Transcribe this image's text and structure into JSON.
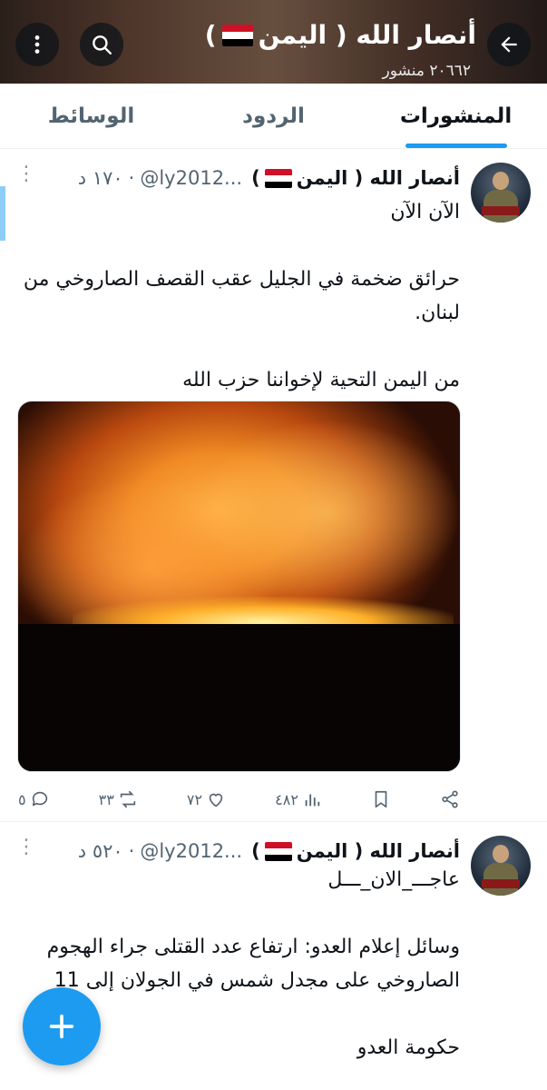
{
  "header": {
    "title": "أنصار الله ( اليمن",
    "title_close": ")",
    "subtitle": "٢٠٦٦٢ منشور"
  },
  "tabs": [
    {
      "label": "المنشورات",
      "active": true
    },
    {
      "label": "الردود",
      "active": false
    },
    {
      "label": "الوسائط",
      "active": false
    }
  ],
  "posts": [
    {
      "name": "أنصار الله ( اليمن",
      "name_close": ")",
      "handle": "@ly2012...",
      "time": "١٧٠ د",
      "text": "الآن الآن\n\nحرائق ضخمة في الجليل عقب القصف الصاروخي من لبنان.\n\nمن اليمن التحية لإخواننا حزب الله",
      "replies": "٥",
      "reposts": "٣٣",
      "likes": "٧٢",
      "views": "٤٨٢"
    },
    {
      "name": "أنصار الله ( اليمن",
      "name_close": ")",
      "handle": "@ly2012...",
      "time": "٥٢٠ د",
      "text": "عاجـــ_الان_ـــل\n\nوسائل إعلام العدو: ارتفاع عدد القتلى جراء الهجوم الصاروخي على مجدل شمس في الجولان إلى 11\n\nحكومة العدو"
    }
  ],
  "icons": {
    "back": "arrow-left-icon",
    "search": "search-icon",
    "more": "more-vertical-icon",
    "compose": "plus-icon"
  },
  "colors": {
    "accent": "#1d9bf0",
    "text": "#0f1419",
    "muted": "#536471"
  }
}
